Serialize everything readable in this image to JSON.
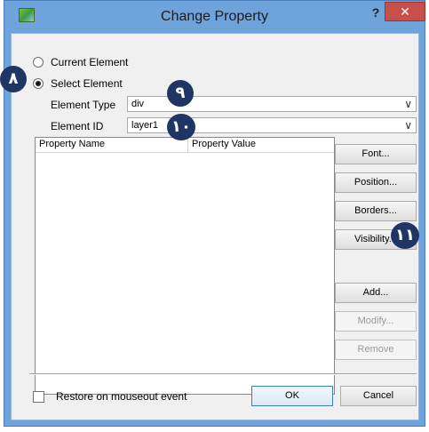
{
  "window": {
    "title": "Change Property",
    "help_glyph": "?",
    "close_glyph": "✕"
  },
  "radios": {
    "current_element": "Current Element",
    "select_element": "Select Element",
    "selected": "select_element"
  },
  "fields": {
    "element_type_label": "Element Type",
    "element_type_value": "div",
    "element_id_label": "Element ID",
    "element_id_value": "layer1"
  },
  "table": {
    "columns": [
      "Property Name",
      "Property Value"
    ],
    "rows": []
  },
  "buttons": {
    "font": "Font...",
    "position": "Position...",
    "borders": "Borders...",
    "visibility": "Visibility...",
    "add": "Add...",
    "modify": "Modify...",
    "remove": "Remove",
    "ok": "OK",
    "cancel": "Cancel"
  },
  "checkbox": {
    "label": "Restore on mouseout event",
    "checked": false
  },
  "badges": {
    "b8": "۸",
    "b9": "۹",
    "b10": "۱۰",
    "b11": "۱۱"
  },
  "colors": {
    "frame": "#6fa3dc",
    "close": "#c7504a",
    "badge": "#1f3564"
  },
  "icons": {
    "app": "app-icon",
    "dropdown": "chevron-down-icon"
  }
}
